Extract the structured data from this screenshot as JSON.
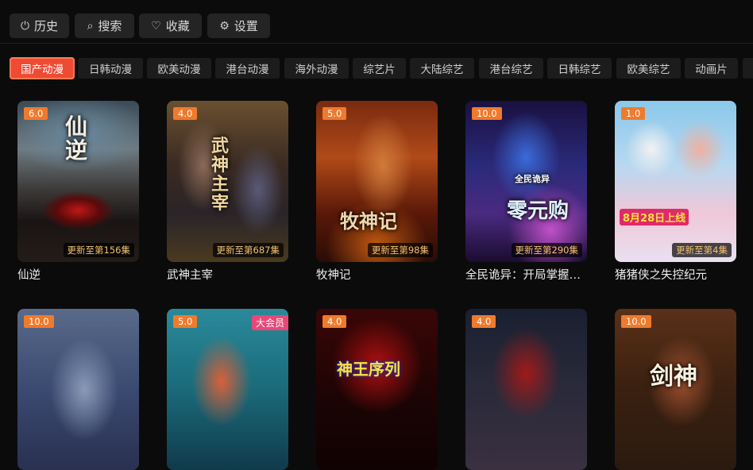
{
  "toolbar": {
    "history": {
      "icon": "power-icon",
      "label": "历史"
    },
    "search": {
      "icon": "search-icon",
      "label": "搜索"
    },
    "favorites": {
      "icon": "heart-icon",
      "label": "收藏"
    },
    "settings": {
      "icon": "gear-icon",
      "label": "设置"
    }
  },
  "tabs": [
    "国产动漫",
    "日韩动漫",
    "欧美动漫",
    "港台动漫",
    "海外动漫",
    "综艺片",
    "大陆综艺",
    "港台综艺",
    "日韩综艺",
    "欧美综艺",
    "动画片"
  ],
  "active_tab": "国产动漫",
  "cards": [
    {
      "title": "仙逆",
      "rating": "6.0",
      "update": "更新至第156集",
      "art": "仙逆"
    },
    {
      "title": "武神主宰",
      "rating": "4.0",
      "update": "更新至第687集",
      "art": "武神主宰"
    },
    {
      "title": "牧神记",
      "rating": "5.0",
      "update": "更新至第98集",
      "art": "牧神记"
    },
    {
      "title": "全民诡异：开局掌握…",
      "rating": "10.0",
      "update": "更新至第290集",
      "art": "零元购",
      "art_sub": "全民诡异"
    },
    {
      "title": "猪猪侠之失控纪元",
      "rating": "1.0",
      "update": "更新至第4集",
      "art": "8月28日上线"
    },
    {
      "title": "",
      "rating": "10.0",
      "update": "",
      "art": ""
    },
    {
      "title": "",
      "rating": "5.0",
      "update": "",
      "art": "",
      "corner": "大会员"
    },
    {
      "title": "",
      "rating": "4.0",
      "update": "",
      "art": "神王序列"
    },
    {
      "title": "",
      "rating": "4.0",
      "update": "",
      "art": ""
    },
    {
      "title": "",
      "rating": "10.0",
      "update": "",
      "art": "剑神"
    }
  ],
  "colors": {
    "accent": "#ef4a33",
    "badge": "#f07a2b",
    "update_text": "#f0c070"
  }
}
